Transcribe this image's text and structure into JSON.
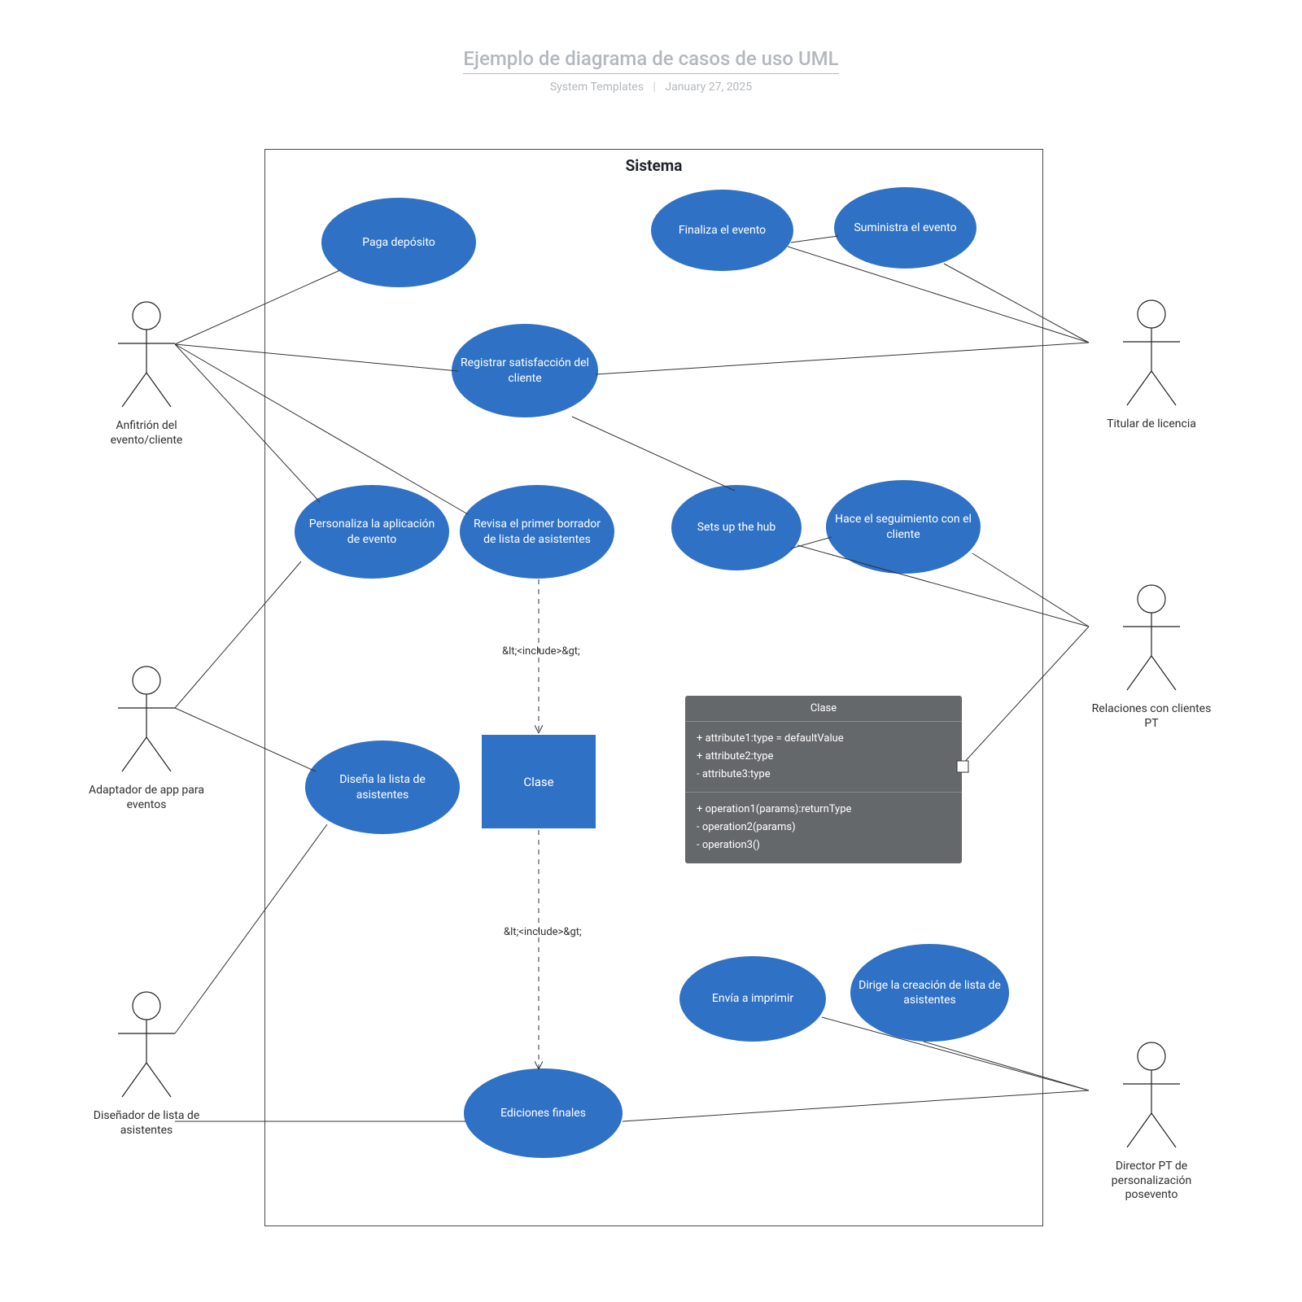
{
  "header": {
    "title": "Ejemplo de diagrama de casos de uso UML",
    "subtitle_left": "System Templates",
    "subtitle_right": "January 27, 2025"
  },
  "system_label": "Sistema",
  "usecases": {
    "paga_deposito": "Paga depósito",
    "finaliza_evento": "Finaliza el evento",
    "suministra_evento": "Suministra el evento",
    "registrar_satisfaccion": "Registrar satisfacción del cliente",
    "personaliza_app": "Personaliza la aplicación de evento",
    "revisa_borrador": "Revisa el primer borrador de lista de asistentes",
    "sets_up_hub": "Sets up the hub",
    "hace_seguimiento": "Hace el seguimiento con el cliente",
    "disena_lista": "Diseña la lista de asistentes",
    "envia_imprimir": "Envía a imprimir",
    "dirige_creacion": "Dirige la creación de lista de asistentes",
    "ediciones_finales": "Ediciones finales"
  },
  "class_small": "Clase",
  "class_big": {
    "title": "Clase",
    "attributes": [
      "+ attribute1:type = defaultValue",
      "+ attribute2:type",
      "- attribute3:type"
    ],
    "operations": [
      "+ operation1(params):returnType",
      "- operation2(params)",
      "- operation3()"
    ]
  },
  "relations": {
    "include1": "&lt;<include>&gt;",
    "include2": "&lt;<include>&gt;"
  },
  "actors": {
    "anfitrion": "Anfitrión del evento/cliente",
    "adaptador": "Adaptador de app para eventos",
    "disenador": "Diseñador de lista de asistentes",
    "titular": "Titular de licencia",
    "relaciones_pt": "Relaciones con clientes PT",
    "director_pt": "Director PT de personalización posevento"
  }
}
